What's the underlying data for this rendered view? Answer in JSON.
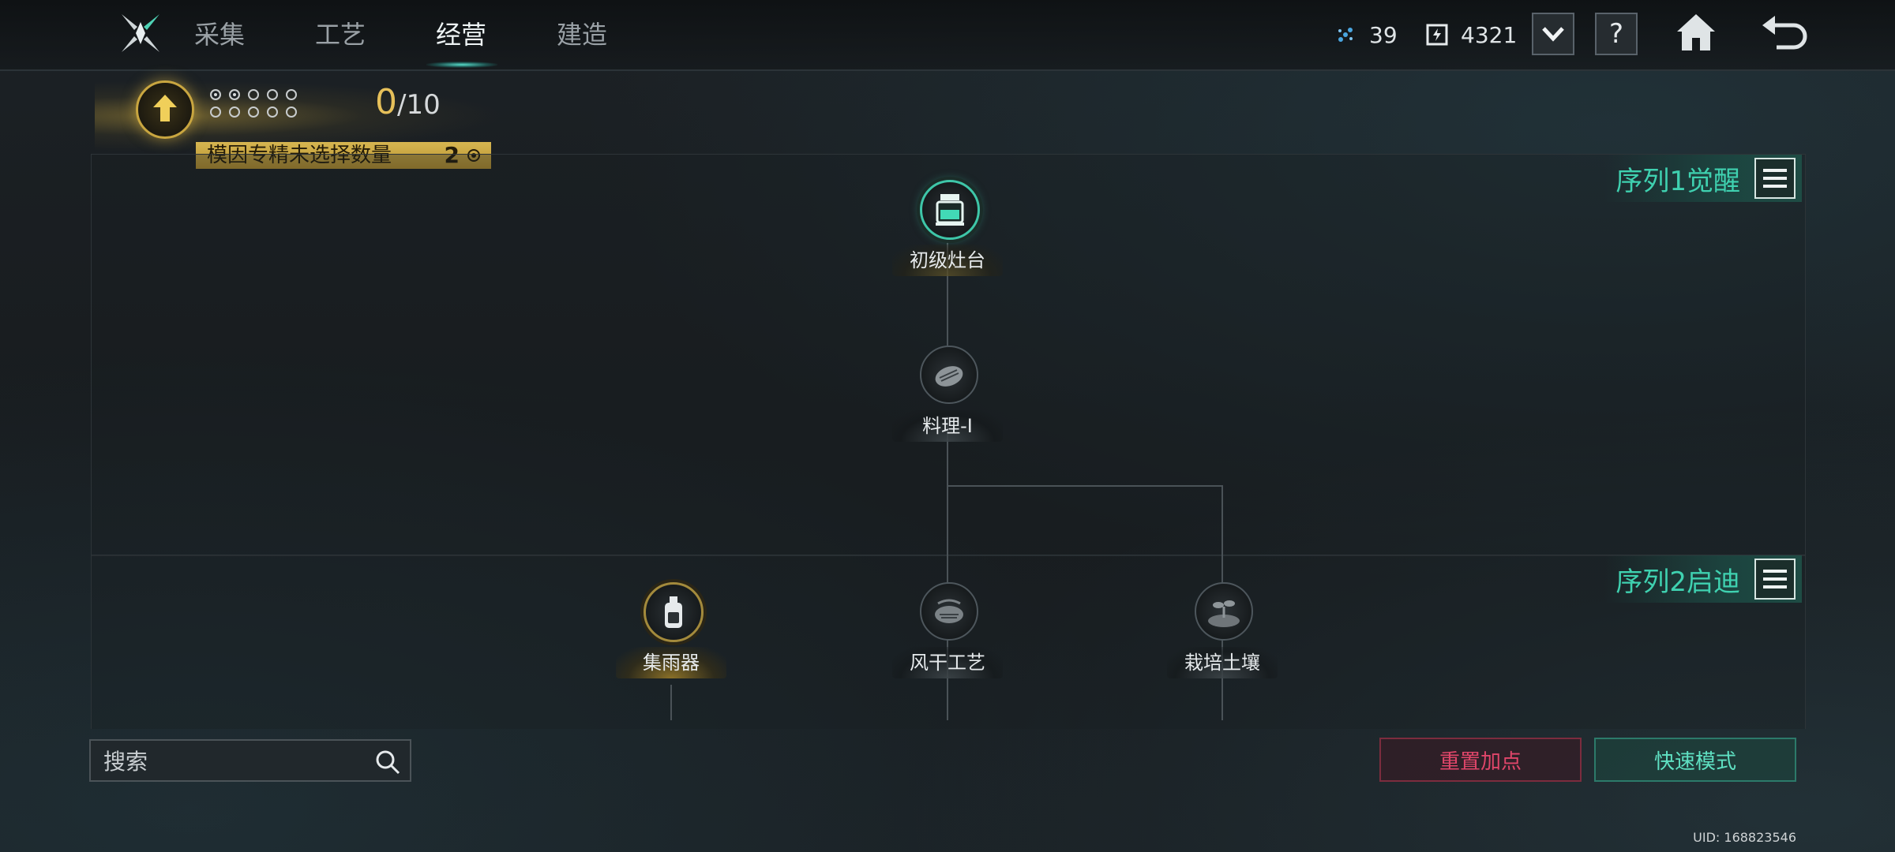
{
  "topbar": {
    "tabs": [
      {
        "label": "采集",
        "active": false
      },
      {
        "label": "工艺",
        "active": false
      },
      {
        "label": "经营",
        "active": true
      },
      {
        "label": "建造",
        "active": false
      }
    ],
    "resources": [
      {
        "icon": "feather-token-icon",
        "value": "39"
      },
      {
        "icon": "energy-box-icon",
        "value": "4321"
      }
    ],
    "help_label": "?"
  },
  "gene": {
    "dots_filled": 2,
    "dots_total": 10,
    "current": "0",
    "separator": "/",
    "max": "10",
    "label": "模因专精未选择数量",
    "unselected_count": "2"
  },
  "sequences": [
    {
      "title": "序列1觉醒"
    },
    {
      "title": "序列2启迪"
    }
  ],
  "nodes": {
    "stove": {
      "label": "初级灶台",
      "icon": "stove-icon",
      "state": "active"
    },
    "cooking": {
      "label": "料理-I",
      "icon": "steak-icon",
      "state": "locked"
    },
    "rain_collector": {
      "label": "集雨器",
      "icon": "bottle-icon",
      "state": "available"
    },
    "air_dry": {
      "label": "风干工艺",
      "icon": "dried-meat-icon",
      "state": "locked"
    },
    "soil": {
      "label": "栽培土壤",
      "icon": "sprout-icon",
      "state": "locked"
    }
  },
  "search": {
    "placeholder": "搜索"
  },
  "buttons": {
    "reset": "重置加点",
    "quick_mode": "快速模式"
  },
  "uid": "UID: 168823546",
  "colors": {
    "accent_teal": "#3fd1b0",
    "gold": "#d6b651",
    "reset_red": "#e0466a"
  }
}
